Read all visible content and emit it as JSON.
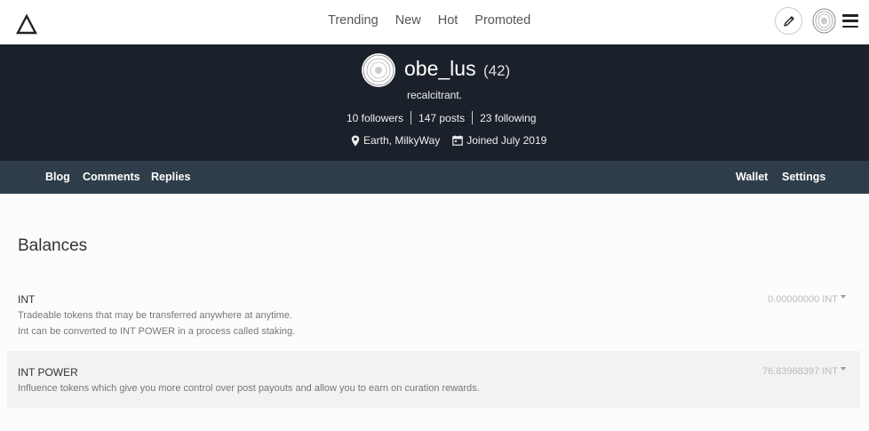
{
  "header": {
    "logo_icon": "triangle-logo",
    "nav": [
      "Trending",
      "New",
      "Hot",
      "Promoted"
    ],
    "compose_icon": "pencil-icon",
    "menu_icon": "hamburger-menu-icon"
  },
  "profile": {
    "username": "obe_lus",
    "reputation": "(42)",
    "about": "recalcitrant.",
    "followers": "10 followers",
    "posts": "147 posts",
    "following": "23 following",
    "location": "Earth, MilkyWay",
    "joined": "Joined July 2019"
  },
  "subnav": {
    "left": [
      "Blog",
      "Comments",
      "Replies"
    ],
    "right": [
      "Wallet",
      "Settings"
    ]
  },
  "balances": {
    "title": "Balances",
    "items": [
      {
        "name": "INT",
        "desc1": "Tradeable tokens that may be transferred anywhere at anytime.",
        "desc2": "Int can be converted to INT POWER in a process called staking.",
        "value": "0.00000000 INT"
      },
      {
        "name": "INT POWER",
        "desc1": "Influence tokens which give you more control over post payouts and allow you to earn on curation rewards.",
        "value": "76.83968397 INT"
      }
    ]
  },
  "colors": {
    "banner": "#1b212a",
    "subnav": "#2f3d4a"
  }
}
